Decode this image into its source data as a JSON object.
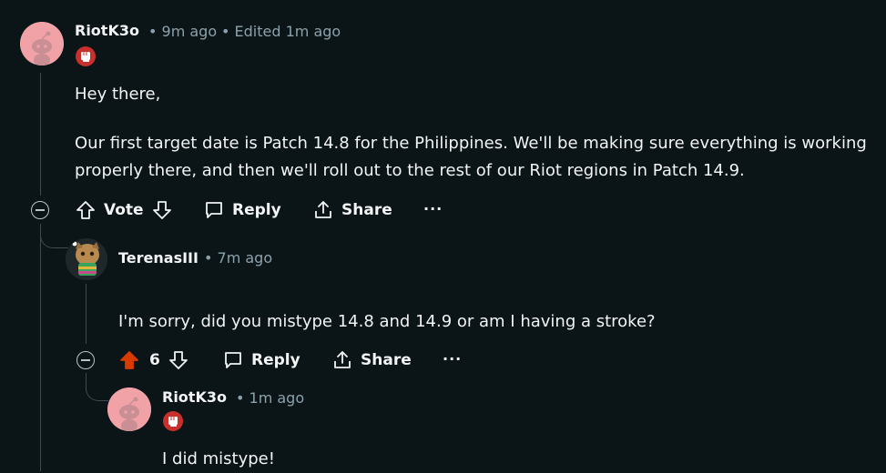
{
  "comments": [
    {
      "author": "RiotK3o",
      "time": "• 9m ago",
      "edited": "• Edited 1m ago",
      "flair_icon": "fist-icon",
      "body": [
        "Hey there,",
        "Our first target date is Patch 14.8 for the Philippines. We'll be making sure everything is working",
        "properly there, and then we'll roll out to the rest of our Riot regions in Patch 14.9."
      ],
      "actions": {
        "vote_label": "Vote",
        "reply_label": "Reply",
        "share_label": "Share",
        "more": "···"
      }
    },
    {
      "author": "TerenasIII",
      "time": "• 7m ago",
      "body": [
        "I'm sorry, did you mistype 14.8 and 14.9 or am I having a stroke?"
      ],
      "actions": {
        "vote_count": "6",
        "reply_label": "Reply",
        "share_label": "Share",
        "more": "···"
      }
    },
    {
      "author": "RiotK3o",
      "time": "• 1m ago",
      "flair_icon": "fist-icon",
      "body": [
        "I did mistype!"
      ]
    }
  ],
  "colors": {
    "background": "#0b1416",
    "upvote_active": "#d93a00",
    "meta_text": "#8ba2ad",
    "avatar_pink": "#f0a2a7",
    "flair_red": "#c7302c"
  }
}
